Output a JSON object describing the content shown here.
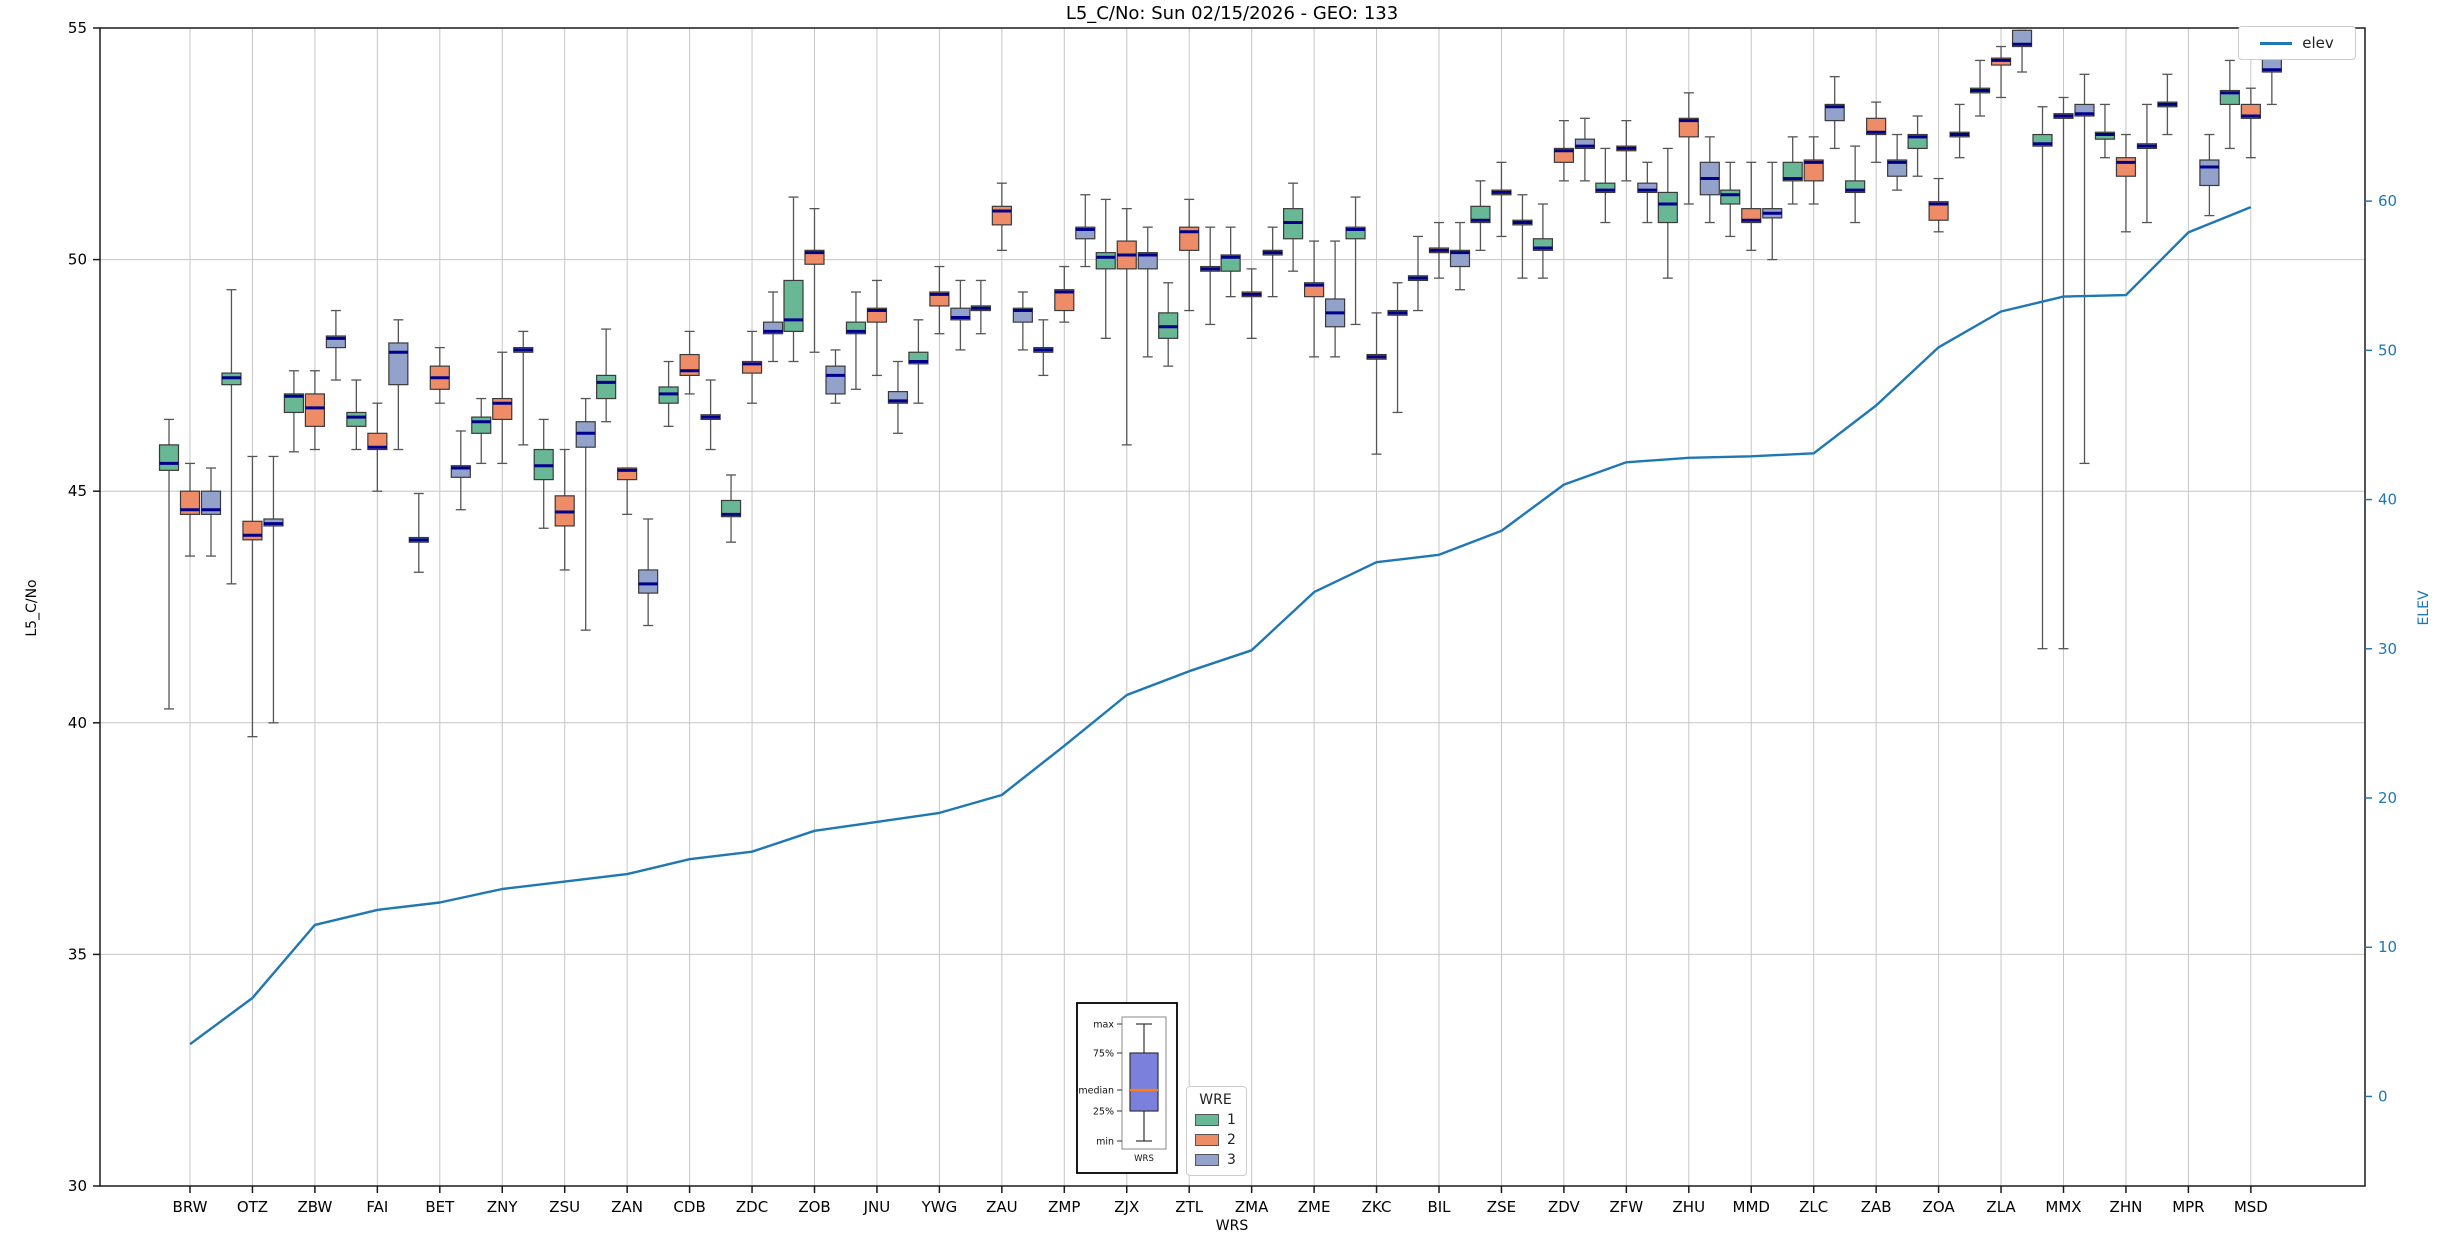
{
  "title": "L5_C/No: Sun 02/15/2026 - GEO: 133",
  "axis": {
    "xlabel": "WRS",
    "ylabel_left": "L5_C/No",
    "ylabel_right": "ELEV"
  },
  "legends": {
    "elev_label": "elev",
    "wre_title": "WRE",
    "wre_entries": [
      "1",
      "2",
      "3"
    ]
  },
  "colors": {
    "wre1": "#68b795",
    "wre2": "#ef8c68",
    "wre3": "#93a2ca",
    "median": "#00008b",
    "elev_line": "#1f77b4",
    "inset_box": "#7b80dd",
    "inset_median": "#ff7f0e"
  },
  "chart_data": {
    "type": "boxplot+line",
    "title": "L5_C/No: Sun 02/15/2026 - GEO: 133",
    "xlabel": "WRS",
    "ylabel_left": "L5_C/No",
    "ylabel_right": "ELEV",
    "ylim_left": [
      30,
      55
    ],
    "yticks_left": [
      30,
      35,
      40,
      45,
      50,
      55
    ],
    "ylim_right": [
      -6,
      71.6
    ],
    "yticks_right": [
      0,
      10,
      20,
      30,
      40,
      50,
      60
    ],
    "grid": true,
    "categories": [
      "BRW",
      "OTZ",
      "ZBW",
      "FAI",
      "BET",
      "ZNY",
      "ZSU",
      "ZAN",
      "CDB",
      "ZDC",
      "ZOB",
      "JNU",
      "YWG",
      "ZAU",
      "ZMP",
      "ZJX",
      "ZTL",
      "ZMA",
      "ZME",
      "ZKC",
      "BIL",
      "ZSE",
      "ZDV",
      "ZFW",
      "ZHU",
      "MMD",
      "ZLC",
      "ZAB",
      "ZOA",
      "ZLA",
      "MMX",
      "ZHN",
      "MPR",
      "MSD"
    ],
    "box_format": [
      "whisker_low",
      "q1",
      "median",
      "q3",
      "whisker_high"
    ],
    "series": [
      {
        "name": "1",
        "color": "#68b795",
        "boxes": [
          [
            40.3,
            45.45,
            45.6,
            46.0,
            46.55
          ],
          [
            43.0,
            47.3,
            47.45,
            47.55,
            49.35
          ],
          [
            45.85,
            46.7,
            47.05,
            47.1,
            47.6
          ],
          [
            45.9,
            46.4,
            46.6,
            46.7,
            47.4
          ],
          [
            43.25,
            43.9,
            43.95,
            44.0,
            44.95
          ],
          [
            45.6,
            46.25,
            46.5,
            46.6,
            47.0
          ],
          [
            44.2,
            45.25,
            45.55,
            45.9,
            46.55
          ],
          [
            46.5,
            47.0,
            47.35,
            47.5,
            48.5
          ],
          [
            46.4,
            46.9,
            47.1,
            47.25,
            47.8
          ],
          [
            43.9,
            44.45,
            44.5,
            44.8,
            45.35
          ],
          [
            47.8,
            48.45,
            48.7,
            49.55,
            51.35
          ],
          [
            47.2,
            48.4,
            48.45,
            48.65,
            49.3
          ],
          [
            46.9,
            47.75,
            47.8,
            48.0,
            48.7
          ],
          [
            48.4,
            48.9,
            48.95,
            49.0,
            49.55
          ],
          [
            47.5,
            48.0,
            48.05,
            48.1,
            48.7
          ],
          [
            48.3,
            49.8,
            50.05,
            50.15,
            51.3
          ],
          [
            47.7,
            48.3,
            48.55,
            48.85,
            49.5
          ],
          [
            49.2,
            49.75,
            50.05,
            50.1,
            50.7
          ],
          [
            49.75,
            50.45,
            50.8,
            51.1,
            51.65
          ],
          [
            48.6,
            50.45,
            50.65,
            50.7,
            51.35
          ],
          [
            48.9,
            49.55,
            49.6,
            49.65,
            50.5
          ],
          [
            50.2,
            50.8,
            50.85,
            51.15,
            51.7
          ],
          [
            49.6,
            50.2,
            50.25,
            50.45,
            51.2
          ],
          [
            50.8,
            51.45,
            51.5,
            51.65,
            52.4
          ],
          [
            49.6,
            50.8,
            51.2,
            51.45,
            52.4
          ],
          [
            50.5,
            51.2,
            51.4,
            51.5,
            52.1
          ],
          [
            51.2,
            51.7,
            51.75,
            52.1,
            52.65
          ],
          [
            50.8,
            51.45,
            51.5,
            51.7,
            52.45
          ],
          [
            51.8,
            52.4,
            52.65,
            52.7,
            53.1
          ],
          [
            53.1,
            53.6,
            53.65,
            53.7,
            54.3
          ],
          [
            41.6,
            52.45,
            52.5,
            52.7,
            53.3
          ],
          [
            52.2,
            52.6,
            52.7,
            52.75,
            53.35
          ],
          [
            52.7,
            53.3,
            53.35,
            53.4,
            54.0
          ],
          [
            52.4,
            53.35,
            53.6,
            53.65,
            54.3
          ]
        ]
      },
      {
        "name": "2",
        "color": "#ef8c68",
        "boxes": [
          [
            43.6,
            44.5,
            44.6,
            45.0,
            45.6
          ],
          [
            39.7,
            43.95,
            44.05,
            44.35,
            45.75
          ],
          [
            45.9,
            46.4,
            46.8,
            47.1,
            47.6
          ],
          [
            45.0,
            45.9,
            45.95,
            46.25,
            46.9
          ],
          [
            46.9,
            47.2,
            47.45,
            47.7,
            48.1
          ],
          [
            45.6,
            46.55,
            46.9,
            47.0,
            48.0
          ],
          [
            43.3,
            44.25,
            44.55,
            44.9,
            45.9
          ],
          [
            44.5,
            45.25,
            45.45,
            45.5,
            45.5
          ],
          [
            47.1,
            47.5,
            47.6,
            47.95,
            48.45
          ],
          [
            46.9,
            47.55,
            47.75,
            47.8,
            48.45
          ],
          [
            48.0,
            49.9,
            50.15,
            50.2,
            51.1
          ],
          [
            47.5,
            48.65,
            48.9,
            48.95,
            49.55
          ],
          [
            48.4,
            49.0,
            49.25,
            49.3,
            49.85
          ],
          [
            50.2,
            50.75,
            51.05,
            51.15,
            51.65
          ],
          [
            48.65,
            48.9,
            49.3,
            49.35,
            49.85
          ],
          [
            46.0,
            49.8,
            50.1,
            50.4,
            51.1
          ],
          [
            48.9,
            50.2,
            50.6,
            50.7,
            51.3
          ],
          [
            48.3,
            49.2,
            49.25,
            49.3,
            49.8
          ],
          [
            47.9,
            49.2,
            49.45,
            49.5,
            50.4
          ],
          [
            45.8,
            47.85,
            47.9,
            47.95,
            48.85
          ],
          [
            49.6,
            50.15,
            50.2,
            50.25,
            50.8
          ],
          [
            50.5,
            51.4,
            51.45,
            51.5,
            52.1
          ],
          [
            51.7,
            52.1,
            52.35,
            52.4,
            53.0
          ],
          [
            51.7,
            52.35,
            52.4,
            52.45,
            53.0
          ],
          [
            51.2,
            52.65,
            53.0,
            53.05,
            53.6
          ],
          [
            50.2,
            50.8,
            50.85,
            51.1,
            52.1
          ],
          [
            51.2,
            51.7,
            52.1,
            52.15,
            52.65
          ],
          [
            52.1,
            52.7,
            52.75,
            53.05,
            53.4
          ],
          [
            50.6,
            50.85,
            51.2,
            51.25,
            51.75
          ],
          [
            53.5,
            54.2,
            54.3,
            54.35,
            54.6
          ],
          [
            41.6,
            53.05,
            53.1,
            53.15,
            53.5
          ],
          [
            50.6,
            51.8,
            52.1,
            52.2,
            52.7
          ],
          null,
          [
            52.2,
            53.05,
            53.1,
            53.35,
            53.7
          ]
        ]
      },
      {
        "name": "3",
        "color": "#93a2ca",
        "boxes": [
          [
            43.6,
            44.5,
            44.6,
            45.0,
            45.5
          ],
          [
            40.0,
            44.25,
            44.3,
            44.4,
            45.75
          ],
          [
            47.4,
            48.1,
            48.3,
            48.35,
            48.9
          ],
          [
            45.9,
            47.3,
            48.0,
            48.2,
            48.7
          ],
          [
            44.6,
            45.3,
            45.5,
            45.55,
            46.3
          ],
          [
            46.0,
            48.0,
            48.05,
            48.1,
            48.45
          ],
          [
            42.0,
            45.95,
            46.25,
            46.5,
            47.0
          ],
          [
            42.1,
            42.8,
            43.0,
            43.3,
            44.4
          ],
          [
            45.9,
            46.55,
            46.6,
            46.65,
            47.4
          ],
          [
            47.8,
            48.4,
            48.45,
            48.65,
            49.3
          ],
          [
            46.9,
            47.1,
            47.5,
            47.7,
            48.05
          ],
          [
            46.25,
            46.9,
            46.95,
            47.15,
            47.8
          ],
          [
            48.05,
            48.7,
            48.75,
            48.95,
            49.55
          ],
          [
            48.05,
            48.65,
            48.9,
            48.95,
            49.3
          ],
          [
            49.85,
            50.45,
            50.65,
            50.7,
            51.4
          ],
          [
            47.9,
            49.8,
            50.1,
            50.15,
            50.7
          ],
          [
            48.6,
            49.75,
            49.8,
            49.85,
            50.7
          ],
          [
            49.2,
            50.1,
            50.15,
            50.2,
            50.7
          ],
          [
            47.9,
            48.55,
            48.85,
            49.15,
            50.4
          ],
          [
            46.7,
            48.8,
            48.85,
            48.9,
            49.5
          ],
          [
            49.35,
            49.85,
            50.15,
            50.2,
            50.8
          ],
          [
            49.6,
            50.75,
            50.8,
            50.85,
            51.4
          ],
          [
            51.7,
            52.4,
            52.45,
            52.6,
            53.05
          ],
          [
            50.8,
            51.45,
            51.5,
            51.65,
            52.1
          ],
          [
            50.8,
            51.4,
            51.75,
            52.1,
            52.65
          ],
          [
            50.0,
            50.9,
            51.0,
            51.1,
            52.1
          ],
          [
            52.4,
            53.0,
            53.3,
            53.35,
            53.95
          ],
          [
            51.5,
            51.8,
            52.1,
            52.15,
            52.7
          ],
          [
            52.2,
            52.65,
            52.7,
            52.75,
            53.35
          ],
          [
            54.05,
            54.6,
            54.65,
            54.95,
            54.95
          ],
          [
            45.6,
            53.1,
            53.15,
            53.35,
            54.0
          ],
          [
            50.8,
            52.4,
            52.45,
            52.5,
            53.35
          ],
          [
            50.95,
            51.6,
            52.0,
            52.15,
            52.7
          ],
          [
            53.35,
            54.05,
            54.1,
            54.35,
            54.65
          ]
        ]
      }
    ],
    "line_series": {
      "name": "elev",
      "color": "#1f77b4",
      "axis": "right",
      "values": [
        3.5,
        6.6,
        11.5,
        12.5,
        13.0,
        13.9,
        14.4,
        14.9,
        15.9,
        16.4,
        17.8,
        18.4,
        19.0,
        20.2,
        23.5,
        26.9,
        28.5,
        29.9,
        33.8,
        35.8,
        36.3,
        37.9,
        41.0,
        42.5,
        42.8,
        42.9,
        43.1,
        46.3,
        50.2,
        52.6,
        53.6,
        53.7,
        57.9,
        59.6
      ]
    },
    "legend_wre": {
      "title": "WRE",
      "entries": [
        "1",
        "2",
        "3"
      ]
    },
    "legend_line": [
      "elev"
    ],
    "inset": {
      "labels": [
        "max",
        "75%",
        "median",
        "25%",
        "min"
      ],
      "xlabel": "WRS"
    }
  }
}
